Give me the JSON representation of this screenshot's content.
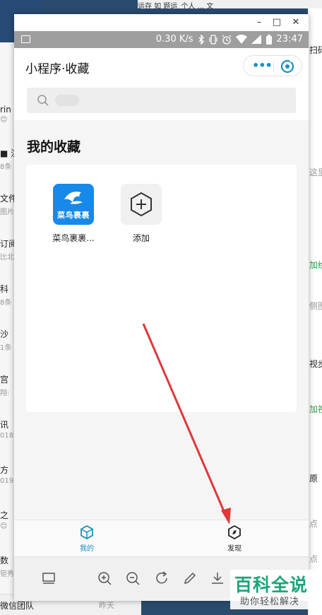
{
  "background": {
    "left_items": [
      {
        "title": "rin",
        "sub": "😊"
      },
      {
        "title": "■ 洪",
        "sub": "8条"
      },
      {
        "title": "文件",
        "sub": "图片"
      },
      {
        "title": "订阅",
        "sub": "比北"
      },
      {
        "title": "科",
        "sub": "8条"
      },
      {
        "title": "沙",
        "sub": "1条"
      },
      {
        "title": "宫",
        "sub": "翔:"
      },
      {
        "title": "讯",
        "sub": "018"
      },
      {
        "title": "方",
        "sub": "019"
      },
      {
        "title": "之",
        "sub": "😊"
      },
      {
        "title": "数",
        "sub": "钜秀"
      }
    ],
    "bottom_item": {
      "title": "微信团队",
      "date": "昨天"
    },
    "top_text": "运存  如 题运_个人 ...  文",
    "right_items": [
      {
        "text": "扫码",
        "style": ""
      },
      {
        "text": "这里",
        "style": "gray"
      },
      {
        "text": "加绘",
        "style": "green"
      },
      {
        "text": "侧图",
        "style": "gray"
      },
      {
        "text": "视步",
        "style": ""
      },
      {
        "text": "加视",
        "style": "green"
      },
      {
        "text": "原",
        "style": ""
      },
      {
        "text": "点",
        "style": "gray"
      },
      {
        "text": "点",
        "style": "gray"
      }
    ]
  },
  "window": {
    "minimize_label": "–",
    "maximize_label": "□",
    "close_label": "✕"
  },
  "statusbar": {
    "speed": "0.30 K/s",
    "time": "23:47"
  },
  "appbar": {
    "title": "小程序·收藏",
    "more_label": "•••"
  },
  "search": {
    "placeholder": "搜索"
  },
  "favorites": {
    "section_title": "我的收藏",
    "items": [
      {
        "label": "菜鸟裹裹...",
        "icon_text": "菜鸟裹裹",
        "icon": "cainiao-bird-icon"
      },
      {
        "label": "添加",
        "icon": "add-hexagon-icon"
      }
    ]
  },
  "tabs": [
    {
      "label": "我的",
      "icon": "cube-icon",
      "active": true,
      "color": "#1a8fbf"
    },
    {
      "label": "发现",
      "icon": "compass-icon",
      "active": false,
      "color": "#222222"
    }
  ],
  "toolbar": {
    "tools": [
      "screen-icon",
      "zoom-in-icon",
      "zoom-out-icon",
      "rotate-icon",
      "pen-icon",
      "download-icon"
    ]
  },
  "watermark": {
    "main": "百科全说",
    "sub": "助你轻松解决"
  },
  "colors": {
    "accent": "#1a8fbf",
    "arrow": "#e0373a",
    "statusbar": "#9e9e9e",
    "cainiao": "#1789e8"
  }
}
